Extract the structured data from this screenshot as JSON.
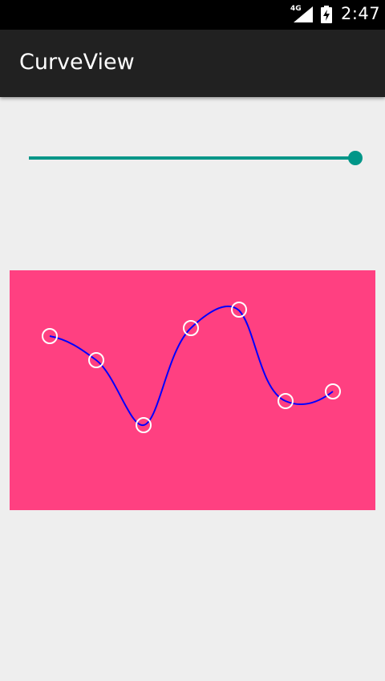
{
  "status_bar": {
    "network_type": "4G",
    "time": "2:47",
    "icons": [
      "signal-icon",
      "battery-charging-icon"
    ]
  },
  "app_bar": {
    "title": "CurveView"
  },
  "slider": {
    "value_fraction": 1.0,
    "color": "#009688"
  },
  "curve_view": {
    "background_color": "#ff4081",
    "curve_color": "#0000ff",
    "control_point_color": "#ffffff",
    "control_point_count": 7
  },
  "colors": {
    "status_bar": "#000000",
    "app_bar": "#212121",
    "page_background": "#eeeeee"
  }
}
